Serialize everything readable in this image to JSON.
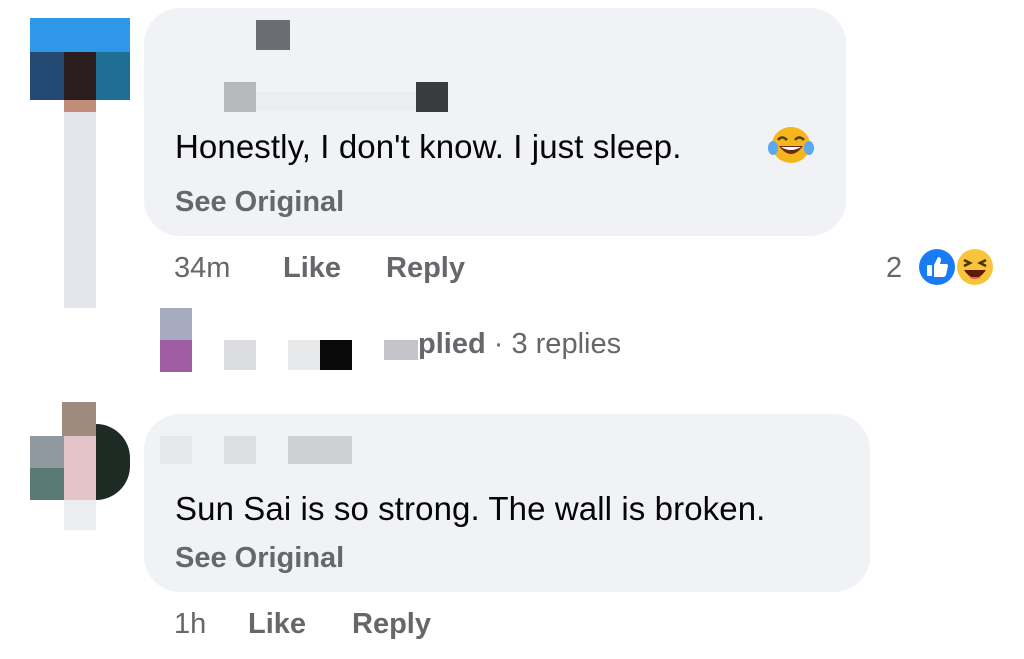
{
  "comments": [
    {
      "text": "Honestly, I don't know. I just sleep.",
      "see_original": "See Original",
      "time": "34m",
      "like": "Like",
      "reply": "Reply",
      "reaction_count": "2",
      "replies_partial": "plied",
      "replies_count": "3 replies",
      "separator": "·"
    },
    {
      "text": "Sun Sai is so strong. The wall is broken.",
      "see_original": "See Original",
      "time": "1h",
      "like": "Like",
      "reply": "Reply"
    }
  ],
  "icons": {
    "emoji": "face-with-tears-of-joy-icon",
    "reaction_like": "like-reaction-icon",
    "reaction_haha": "haha-reaction-icon"
  },
  "colors": {
    "bubble": "#f0f2f5",
    "secondary_text": "#65676b",
    "like_blue": "#0866ff"
  }
}
